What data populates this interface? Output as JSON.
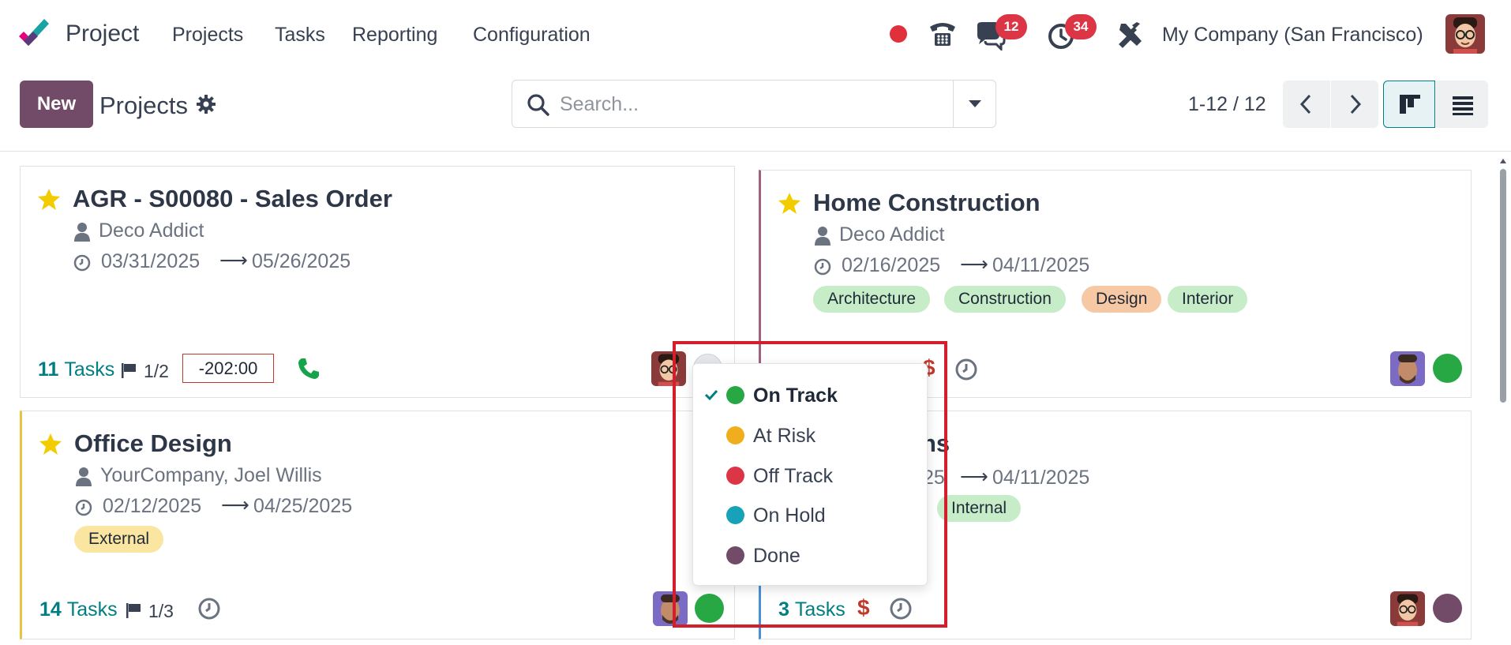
{
  "app": {
    "name": "Project"
  },
  "nav": {
    "items": [
      "Projects",
      "Tasks",
      "Reporting",
      "Configuration"
    ],
    "messages_badge": "12",
    "activities_badge": "34",
    "company": "My Company (San Francisco)"
  },
  "control": {
    "new_label": "New",
    "title": "Projects",
    "search_placeholder": "Search...",
    "pager": "1-12 / 12"
  },
  "cards": [
    {
      "title": "AGR - S00080 - Sales Order",
      "customer": "Deco Addict",
      "date_start": "03/31/2025",
      "date_end": "05/26/2025",
      "tasks_count": "11",
      "tasks_label": "Tasks",
      "milestones": "1/2",
      "hours": "-202:00",
      "tags": []
    },
    {
      "title": "Home Construction",
      "customer": "Deco Addict",
      "date_start": "02/16/2025",
      "date_end": "04/11/2025",
      "tags": [
        "Architecture",
        "Construction",
        "Design",
        "Interior"
      ]
    },
    {
      "title": "Office Design",
      "customer": "YourCompany, Joel Willis",
      "date_start": "02/12/2025",
      "date_end": "04/25/2025",
      "tasks_count": "14",
      "tasks_label": "Tasks",
      "milestones": "1/3",
      "tags": [
        "External"
      ]
    },
    {
      "title_partial": "ns",
      "date_start_partial": "25",
      "date_end": "04/11/2025",
      "tasks_count": "3",
      "tasks_label": "Tasks",
      "tags": [
        "Internal"
      ]
    }
  ],
  "status_menu": {
    "items": [
      {
        "label": "On Track",
        "color": "#28a745",
        "selected": true
      },
      {
        "label": "At Risk",
        "color": "#f0ad1e",
        "selected": false
      },
      {
        "label": "Off Track",
        "color": "#dc3545",
        "selected": false
      },
      {
        "label": "On Hold",
        "color": "#17a2b8",
        "selected": false
      },
      {
        "label": "Done",
        "color": "#714b67",
        "selected": false
      }
    ]
  },
  "colors": {
    "brand": "#714b67",
    "teal": "#017e84",
    "tag_green": "#c7ecc8",
    "tag_orange": "#f6c8a4",
    "tag_yellow": "#fbe6a1",
    "status_green": "#28a745",
    "status_purple": "#714b67"
  },
  "glyphs": {
    "arrow": "⟶",
    "dollar": "$"
  }
}
